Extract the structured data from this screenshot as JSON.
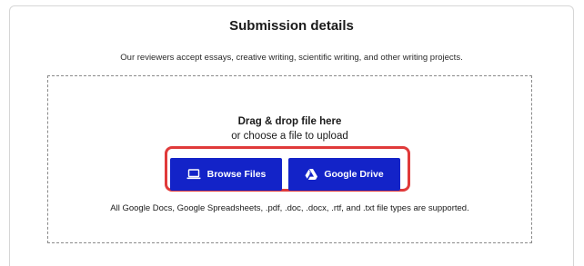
{
  "submission": {
    "title": "Submission details",
    "description": "Our reviewers accept essays, creative writing, scientific writing, and other writing projects."
  },
  "dropzone": {
    "heading": "Drag & drop file here",
    "subheading": "or choose a file to upload",
    "supported_types": "All Google Docs, Google Spreadsheets, .pdf, .doc, .docx, .rtf, and .txt file types are supported."
  },
  "buttons": {
    "browse_label": "Browse Files",
    "browse_icon": "laptop-icon",
    "drive_label": "Google Drive",
    "drive_icon": "google-drive-icon"
  },
  "colors": {
    "button_bg": "#1323c8",
    "highlight_border": "#e03a3a",
    "dashed_border": "#8a8a8a"
  }
}
